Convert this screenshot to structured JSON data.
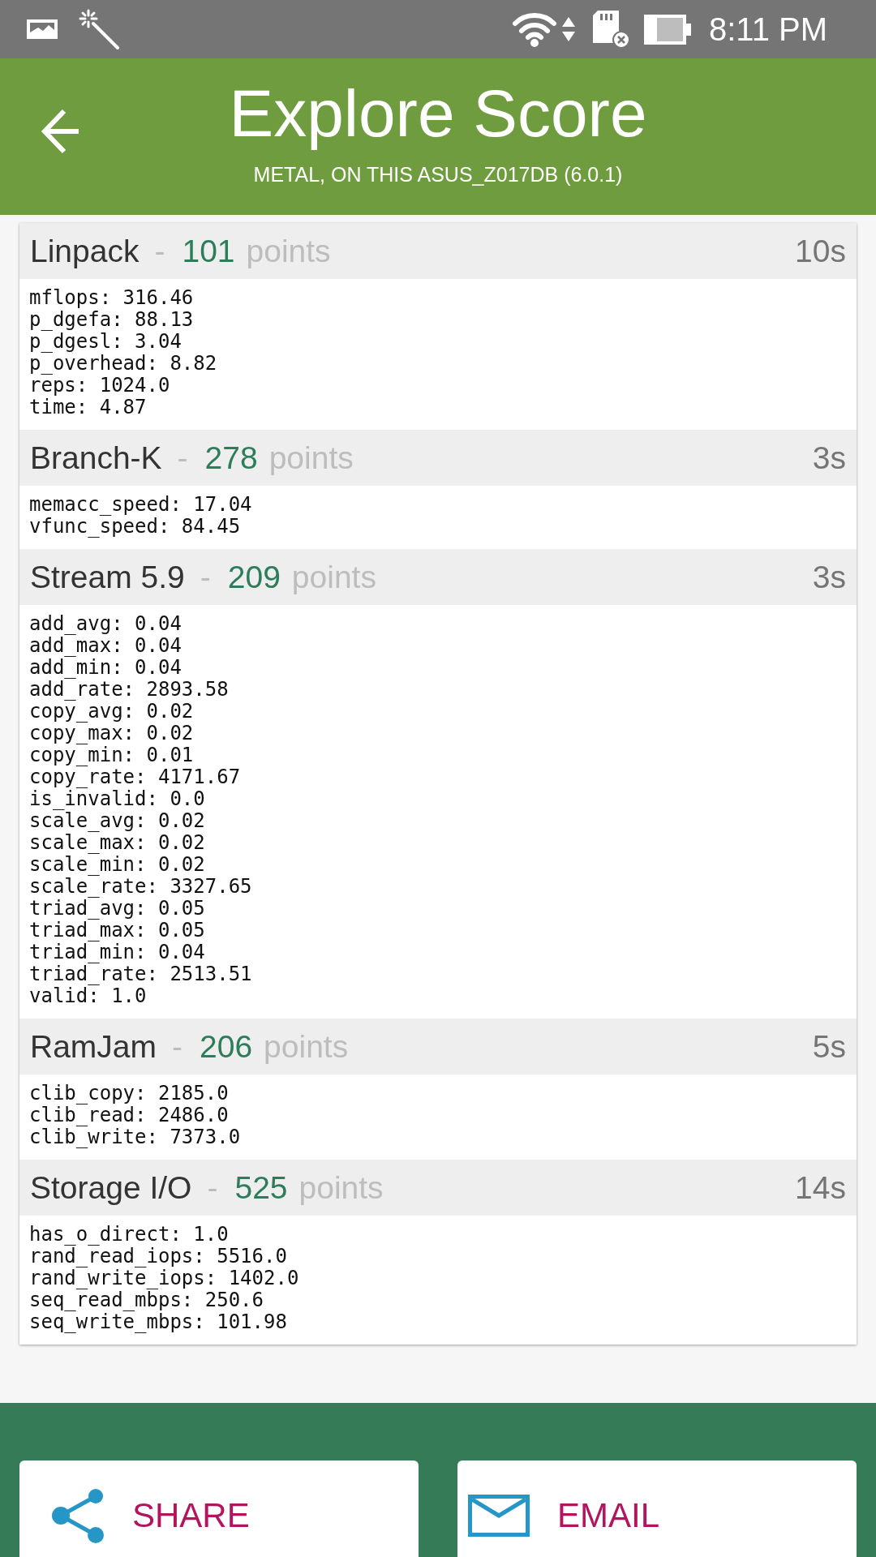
{
  "status_bar": {
    "time": "8:11 PM"
  },
  "app_bar": {
    "title": "Explore Score",
    "subtitle": "METAL, ON THIS ASUS_Z017DB (6.0.1)"
  },
  "results": [
    {
      "name": "Linpack",
      "separator": "-",
      "score": "101",
      "unit": "points",
      "duration": "10s",
      "metrics": [
        "mflops: 316.46",
        "p_dgefa: 88.13",
        "p_dgesl: 3.04",
        "p_overhead: 8.82",
        "reps: 1024.0",
        "time: 4.87"
      ]
    },
    {
      "name": "Branch-K",
      "separator": "-",
      "score": "278",
      "unit": "points",
      "duration": "3s",
      "metrics": [
        "memacc_speed: 17.04",
        "vfunc_speed: 84.45"
      ]
    },
    {
      "name": "Stream 5.9",
      "separator": "-",
      "score": "209",
      "unit": "points",
      "duration": "3s",
      "metrics": [
        "add_avg: 0.04",
        "add_max: 0.04",
        "add_min: 0.04",
        "add_rate: 2893.58",
        "copy_avg: 0.02",
        "copy_max: 0.02",
        "copy_min: 0.01",
        "copy_rate: 4171.67",
        "is_invalid: 0.0",
        "scale_avg: 0.02",
        "scale_max: 0.02",
        "scale_min: 0.02",
        "scale_rate: 3327.65",
        "triad_avg: 0.05",
        "triad_max: 0.05",
        "triad_min: 0.04",
        "triad_rate: 2513.51",
        "valid: 1.0"
      ]
    },
    {
      "name": "RamJam",
      "separator": "-",
      "score": "206",
      "unit": "points",
      "duration": "5s",
      "metrics": [
        "clib_copy: 2185.0",
        "clib_read: 2486.0",
        "clib_write: 7373.0"
      ]
    },
    {
      "name": "Storage I/O",
      "separator": "-",
      "score": "525",
      "unit": "points",
      "duration": "14s",
      "metrics": [
        "has_o_direct: 1.0",
        "rand_read_iops: 5516.0",
        "rand_write_iops: 1402.0",
        "seq_read_mbps: 250.6",
        "seq_write_mbps: 101.98"
      ]
    }
  ],
  "actions": [
    {
      "kind": "share",
      "label": "SHARE"
    },
    {
      "kind": "email",
      "label": "EMAIL"
    }
  ]
}
